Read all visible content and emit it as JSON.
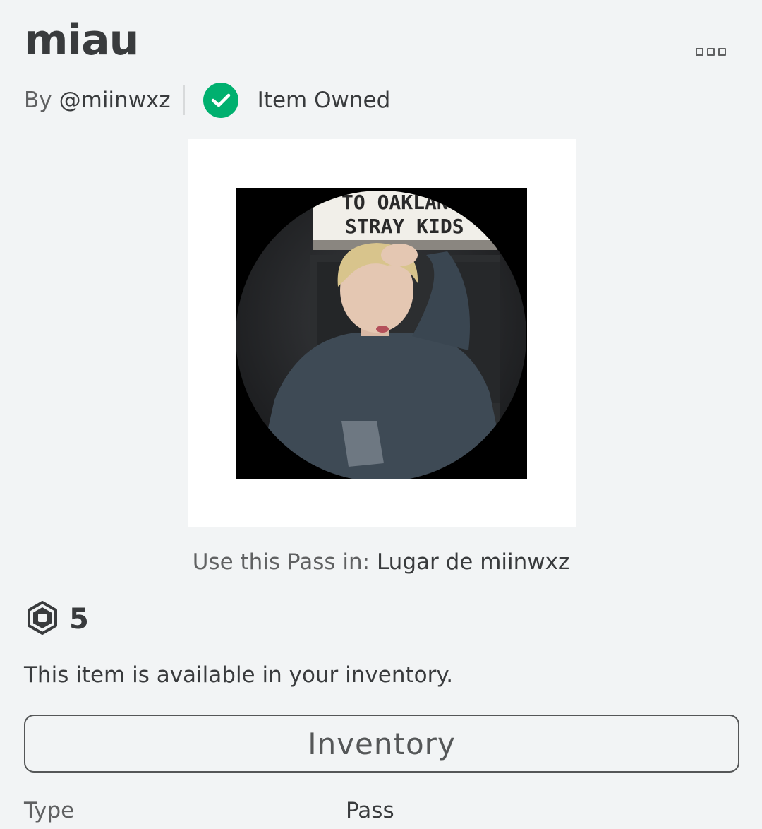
{
  "item": {
    "title": "miau",
    "by_prefix": "By",
    "creator": "@miinwxz",
    "owned_label": "Item Owned"
  },
  "thumbnail": {
    "alt": "Game pass thumbnail",
    "sign_line1": "TO OAKLAN",
    "sign_line2": "STRAY KIDS"
  },
  "use_pass": {
    "label": "Use this Pass in:",
    "place": "Lugar de miinwxz"
  },
  "price": {
    "currency_icon": "robux-icon",
    "value": "5"
  },
  "availability_text": "This item is available in your inventory.",
  "inventory_button": "Inventory",
  "details": {
    "type_label": "Type",
    "type_value": "Pass"
  },
  "colors": {
    "background": "#f2f4f5",
    "owned_green": "#00b06f",
    "text_primary": "#393b3d",
    "text_secondary": "#606162"
  }
}
